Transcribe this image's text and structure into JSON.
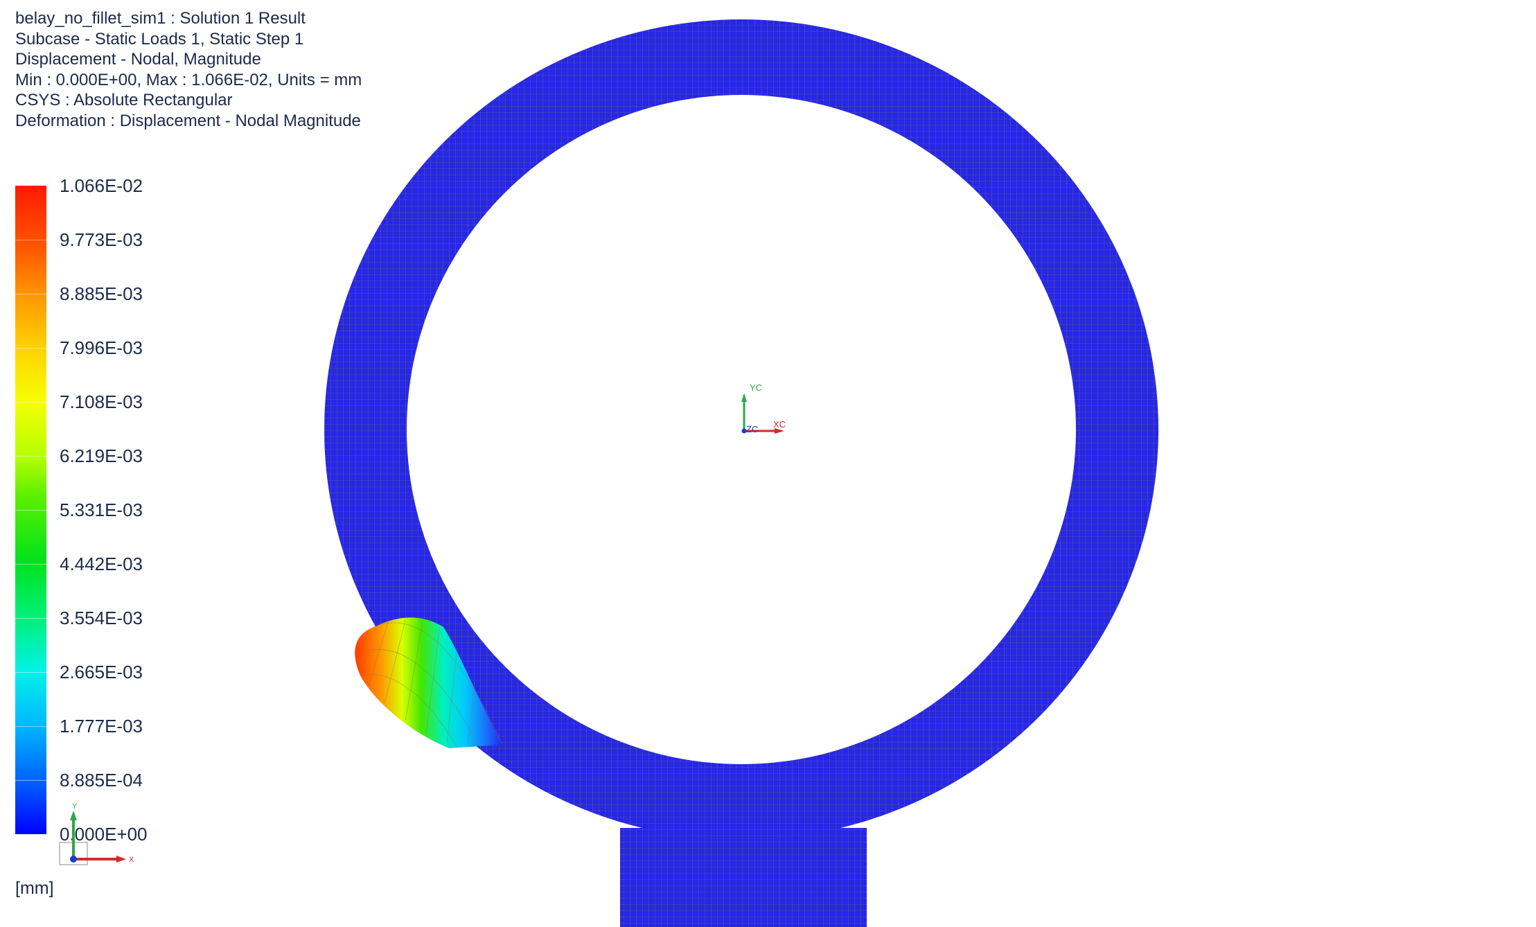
{
  "header": {
    "line1": "belay_no_fillet_sim1 : Solution 1 Result",
    "line2": "Subcase - Static Loads 1, Static Step 1",
    "line3": "Displacement - Nodal, Magnitude",
    "line4": "Min : 0.000E+00, Max : 1.066E-02, Units = mm",
    "line5": "CSYS : Absolute Rectangular",
    "line6": "Deformation : Displacement - Nodal Magnitude"
  },
  "legend": {
    "labels": [
      "1.066E-02",
      "9.773E-03",
      "8.885E-03",
      "7.996E-03",
      "7.108E-03",
      "6.219E-03",
      "5.331E-03",
      "4.442E-03",
      "3.554E-03",
      "2.665E-03",
      "1.777E-03",
      "8.885E-04",
      "0.000E+00"
    ],
    "unit": "[mm]",
    "max_color": "#ff1a00",
    "min_color": "#0000ff"
  },
  "model": {
    "mesh_color": "#2626e8",
    "mesh_line_color": "#7f7f50"
  },
  "triad_center": {
    "x": "XC",
    "y": "YC",
    "z": "ZC"
  },
  "triad_corner": {
    "x": "X",
    "y": "Y"
  }
}
